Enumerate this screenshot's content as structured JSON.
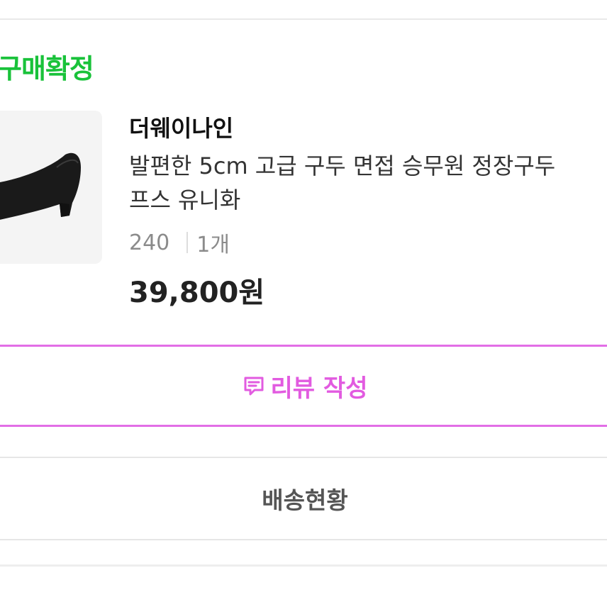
{
  "order": {
    "status_label": "구매확정",
    "product": {
      "brand": "더웨이나인",
      "name_line1": "발편한 5cm 고급 구두 면접 승무원 정장구두",
      "name_line2": "프스 유니화",
      "option_size": "240",
      "option_qty": "1개",
      "price": "39,800원",
      "image_icon": "black-pump-shoe-image"
    },
    "buttons": {
      "review_label": "리뷰 작성",
      "review_icon": "comment-icon",
      "delivery_label": "배송현황"
    }
  },
  "colors": {
    "status": "#19c23a",
    "review_accent": "#e25be0",
    "text_primary": "#222222",
    "text_muted": "#8b8b8b"
  }
}
